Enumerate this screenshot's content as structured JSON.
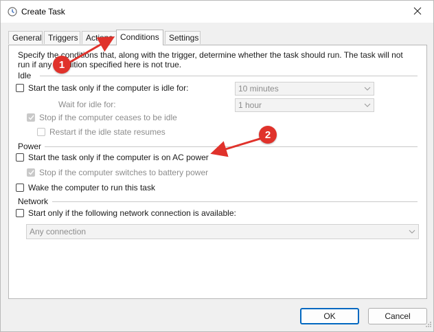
{
  "window": {
    "title": "Create Task"
  },
  "tabs": [
    {
      "label": "General"
    },
    {
      "label": "Triggers"
    },
    {
      "label": "Actions"
    },
    {
      "label": "Conditions"
    },
    {
      "label": "Settings"
    }
  ],
  "active_tab": "Conditions",
  "description": "Specify the conditions that, along with the trigger, determine whether the task should run.  The task will not run  if any condition specified here is not true.",
  "idle": {
    "title": "Idle",
    "start_if_idle": {
      "label": "Start the task only if the computer is idle for:",
      "checked": false
    },
    "idle_duration": {
      "value": "10 minutes"
    },
    "wait_label": "Wait for idle for:",
    "wait_duration": {
      "value": "1 hour"
    },
    "stop_if_ceases": {
      "label": "Stop if the computer ceases to be idle",
      "checked": true,
      "enabled": false
    },
    "restart_if_resumes": {
      "label": "Restart if the idle state resumes",
      "checked": false,
      "enabled": false
    }
  },
  "power": {
    "title": "Power",
    "ac_power": {
      "label": "Start the task only if the computer is on AC power",
      "checked": false
    },
    "stop_on_battery": {
      "label": "Stop if the computer switches to battery power",
      "checked": true,
      "enabled": false
    },
    "wake": {
      "label": "Wake the computer to run this task",
      "checked": false
    }
  },
  "network": {
    "title": "Network",
    "start_if_network": {
      "label": "Start only if the following network connection is available:",
      "checked": false
    },
    "connection": {
      "value": "Any connection"
    }
  },
  "buttons": {
    "ok": "OK",
    "cancel": "Cancel"
  },
  "annotations": [
    {
      "number": "1",
      "color": "#e0322b"
    },
    {
      "number": "2",
      "color": "#e0322b"
    }
  ],
  "colors": {
    "accent": "#0067c0",
    "annotation": "#e0322b",
    "panel": "#ffffff",
    "window": "#f0f0f0"
  }
}
